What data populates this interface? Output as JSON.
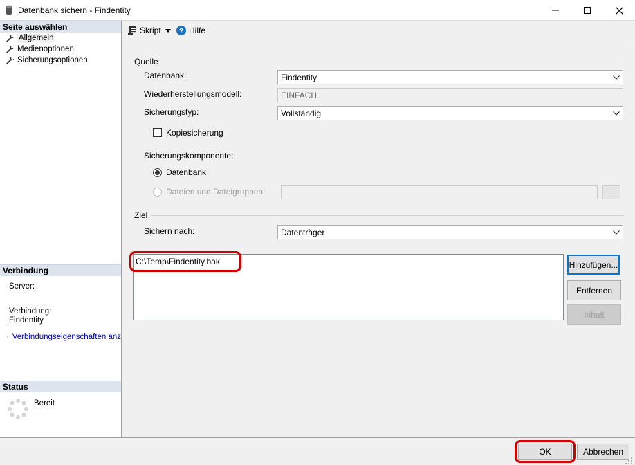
{
  "window": {
    "title": "Datenbank sichern - Findentity",
    "minimize": "—",
    "maximize": "☐",
    "close": "✕"
  },
  "sidebar": {
    "pages_header": "Seite auswählen",
    "pages": [
      {
        "label": "Allgemein",
        "selected": true
      },
      {
        "label": "Medienoptionen",
        "selected": false
      },
      {
        "label": "Sicherungsoptionen",
        "selected": false
      }
    ],
    "connection_header": "Verbindung",
    "server_label": "Server:",
    "connection_label": "Verbindung:",
    "connection_value": "Findentity",
    "connection_link": "Verbindungseigenschaften anz",
    "status_header": "Status",
    "status_text": "Bereit"
  },
  "toolbar": {
    "script_label": "Skript",
    "help_label": "Hilfe"
  },
  "source": {
    "group_label": "Quelle",
    "database_label": "Datenbank:",
    "database_value": "Findentity",
    "recovery_label": "Wiederherstellungsmodell:",
    "recovery_value": "EINFACH",
    "backup_type_label": "Sicherungstyp:",
    "backup_type_value": "Vollständig",
    "copy_only_label": "Kopiesicherung",
    "component_label": "Sicherungskomponente:",
    "component_db_label": "Datenbank",
    "component_files_label": "Dateien und Dateigruppen:",
    "files_browse_label": "..."
  },
  "destination": {
    "group_label": "Ziel",
    "backup_to_label": "Sichern nach:",
    "backup_to_value": "Datenträger",
    "files": [
      "C:\\Temp\\Findentity.bak"
    ],
    "add_label": "Hinzufügen...",
    "remove_label": "Entfernen",
    "contents_label": "Inhalt"
  },
  "footer": {
    "ok_label": "OK",
    "cancel_label": "Abbrechen"
  },
  "colors": {
    "highlight": "#d40000",
    "link": "#0000c0",
    "section_header": "#dde4ee",
    "help_icon": "#1e73be"
  }
}
